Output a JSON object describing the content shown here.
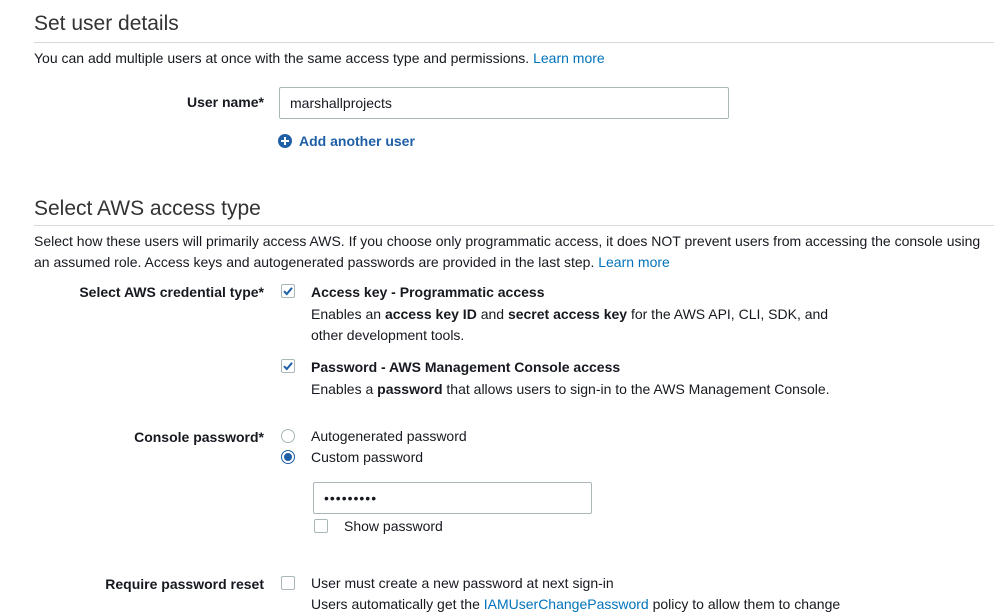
{
  "set_user_details": {
    "heading": "Set user details",
    "description": "You can add multiple users at once with the same access type and permissions.",
    "learn_more": "Learn more",
    "user_name_label": "User name*",
    "user_name_value": "marshallprojects",
    "add_another_user": "Add another user"
  },
  "access_type": {
    "heading": "Select AWS access type",
    "description": "Select how these users will primarily access AWS. If you choose only programmatic access, it does NOT prevent users from accessing the console using an assumed role. Access keys and autogenerated passwords are provided in the last step.",
    "learn_more": "Learn more",
    "credential_label": "Select AWS credential type*",
    "options": [
      {
        "title": "Access key - Programmatic access",
        "checked": true,
        "desc_1": "Enables an ",
        "desc_b1": "access key ID",
        "desc_2": " and ",
        "desc_b2": "secret access key",
        "desc_3": " for the AWS API, CLI, SDK, and",
        "desc_4": "other development tools."
      },
      {
        "title": "Password - AWS Management Console access",
        "checked": true,
        "desc_1": "Enables a ",
        "desc_b1": "password",
        "desc_2": " that allows users to sign-in to the AWS Management Console."
      }
    ]
  },
  "console_password": {
    "label": "Console password*",
    "autogenerated": "Autogenerated password",
    "custom": "Custom password",
    "selected": "custom",
    "password_value": "•••••••••",
    "show_password": "Show password",
    "show_password_checked": false
  },
  "password_reset": {
    "label": "Require password reset",
    "checked": false,
    "option": "User must create a new password at next sign-in",
    "note_1": "Users automatically get the ",
    "note_link": "IAMUserChangePassword",
    "note_2": " policy to allow them to change"
  },
  "colors": {
    "link": "#0073bb",
    "check": "#1f5fa6",
    "border": "#aab7b8"
  }
}
